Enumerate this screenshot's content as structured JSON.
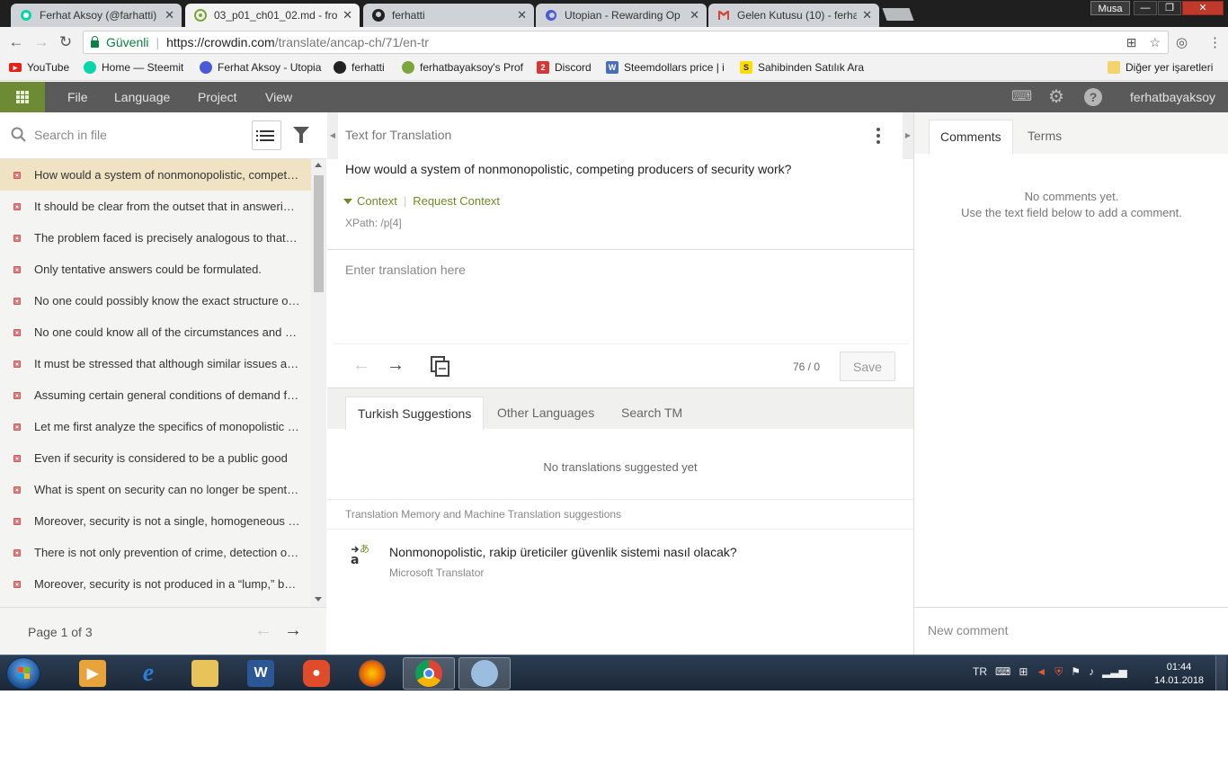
{
  "browser": {
    "tabs": [
      {
        "title": "Ferhat Aksoy (@farhatti)",
        "favicon": "steemit-icon",
        "active": false
      },
      {
        "title": "03_p01_ch01_02.md - fro",
        "favicon": "crowdin-icon",
        "active": true
      },
      {
        "title": "ferhatti",
        "favicon": "github-icon",
        "active": false
      },
      {
        "title": "Utopian - Rewarding Op",
        "favicon": "utopian-icon",
        "active": false
      },
      {
        "title": "Gelen Kutusu (10) - ferha",
        "favicon": "gmail-icon",
        "active": false
      }
    ],
    "window_user": "Musa",
    "window_controls": {
      "minimize": "—",
      "maximize": "❐",
      "close": "✕"
    },
    "security_label": "Güvenli",
    "url_scheme_host": "https://crowdin.com",
    "url_path": "/translate/ancap-ch/71/en-tr",
    "bookmarks": [
      {
        "label": "YouTube",
        "icon": "youtube-icon",
        "color": "#e62117"
      },
      {
        "label": "Home — Steemit",
        "icon": "steemit-icon",
        "color": "#06d6a9"
      },
      {
        "label": "Ferhat Aksoy - Utopia",
        "icon": "utopian-icon",
        "color": "#4a5ad4"
      },
      {
        "label": "ferhatti",
        "icon": "github-icon",
        "color": "#222222"
      },
      {
        "label": "ferhatbayaksoy's Prof",
        "icon": "crowdin-icon",
        "color": "#7aa63a"
      },
      {
        "label": "Discord",
        "icon": "discord-icon",
        "color": "#d63636"
      },
      {
        "label": "Steemdollars price | i",
        "icon": "webpage-icon",
        "color": "#4a6fb5"
      },
      {
        "label": "Sahibinden Satılık Ara",
        "icon": "sahibinden-icon",
        "color": "#ffdd00"
      }
    ],
    "other_bookmarks": "Diğer yer işaretleri"
  },
  "app": {
    "menu": [
      "File",
      "Language",
      "Project",
      "View"
    ],
    "username": "ferhatbayaksoy",
    "accent": "#6d8b34"
  },
  "left": {
    "search_placeholder": "Search in file",
    "strings": [
      "How would a system of nonmonopolistic, competing producers of security work?",
      "It should be clear from the outset that in answering this question",
      "The problem faced is precisely analogous to that faced by the socialist planners",
      "Only tentative answers could be formulated.",
      "No one could possibly know the exact structure of the security industry",
      "No one could know all of the circumstances and conditions",
      "It must be stressed that although similar issues arise",
      "Assuming certain general conditions of demand for security",
      "Let me first analyze the specifics of monopolistic security production",
      "Even if security is considered to be a public good",
      "What is spent on security can no longer be spent on other goods",
      "Moreover, security is not a single, homogeneous good",
      "There is not only prevention of crime, detection of crime",
      "Moreover, security is not produced in a “lump,” but in discrete units"
    ],
    "active_index": 0,
    "page_label": "Page 1 of 3"
  },
  "center": {
    "source_heading": "Text for Translation",
    "source_text": "How would a system of nonmonopolistic, competing producers of security work?",
    "context_label": "Context",
    "request_context_label": "Request Context",
    "xpath": "XPath: /p[4]",
    "translation_placeholder": "Enter translation here",
    "counter": "76 / 0",
    "save_label": "Save",
    "suggestion_tabs": [
      "Turkish Suggestions",
      "Other Languages",
      "Search TM"
    ],
    "no_translations": "No translations suggested yet",
    "tm_heading": "Translation Memory and Machine Translation suggestions",
    "mt_suggestion": "Nonmonopolistic, rakip üreticiler güvenlik sistemi nasıl olacak?",
    "mt_source": "Microsoft Translator"
  },
  "right": {
    "tabs": [
      "Comments",
      "Terms"
    ],
    "no_comments_line1": "No comments yet.",
    "no_comments_line2": "Use the text field below to add a comment.",
    "new_comment_placeholder": "New comment"
  },
  "taskbar": {
    "apps": [
      {
        "icon": "media-player-icon",
        "color": "#e8a33a"
      },
      {
        "icon": "internet-explorer-icon",
        "color": "#2a7fd4"
      },
      {
        "icon": "file-explorer-icon",
        "color": "#e8c35a"
      },
      {
        "icon": "word-icon",
        "color": "#2b5797"
      },
      {
        "icon": "recorder-icon",
        "color": "#e04b2a"
      },
      {
        "icon": "firefox-icon",
        "color": "#e66000"
      },
      {
        "icon": "chrome-icon",
        "color": "#db4437"
      },
      {
        "icon": "paint-icon",
        "color": "#9bbde0"
      }
    ],
    "language": "TR",
    "time": "01:44",
    "date": "14.01.2018"
  }
}
